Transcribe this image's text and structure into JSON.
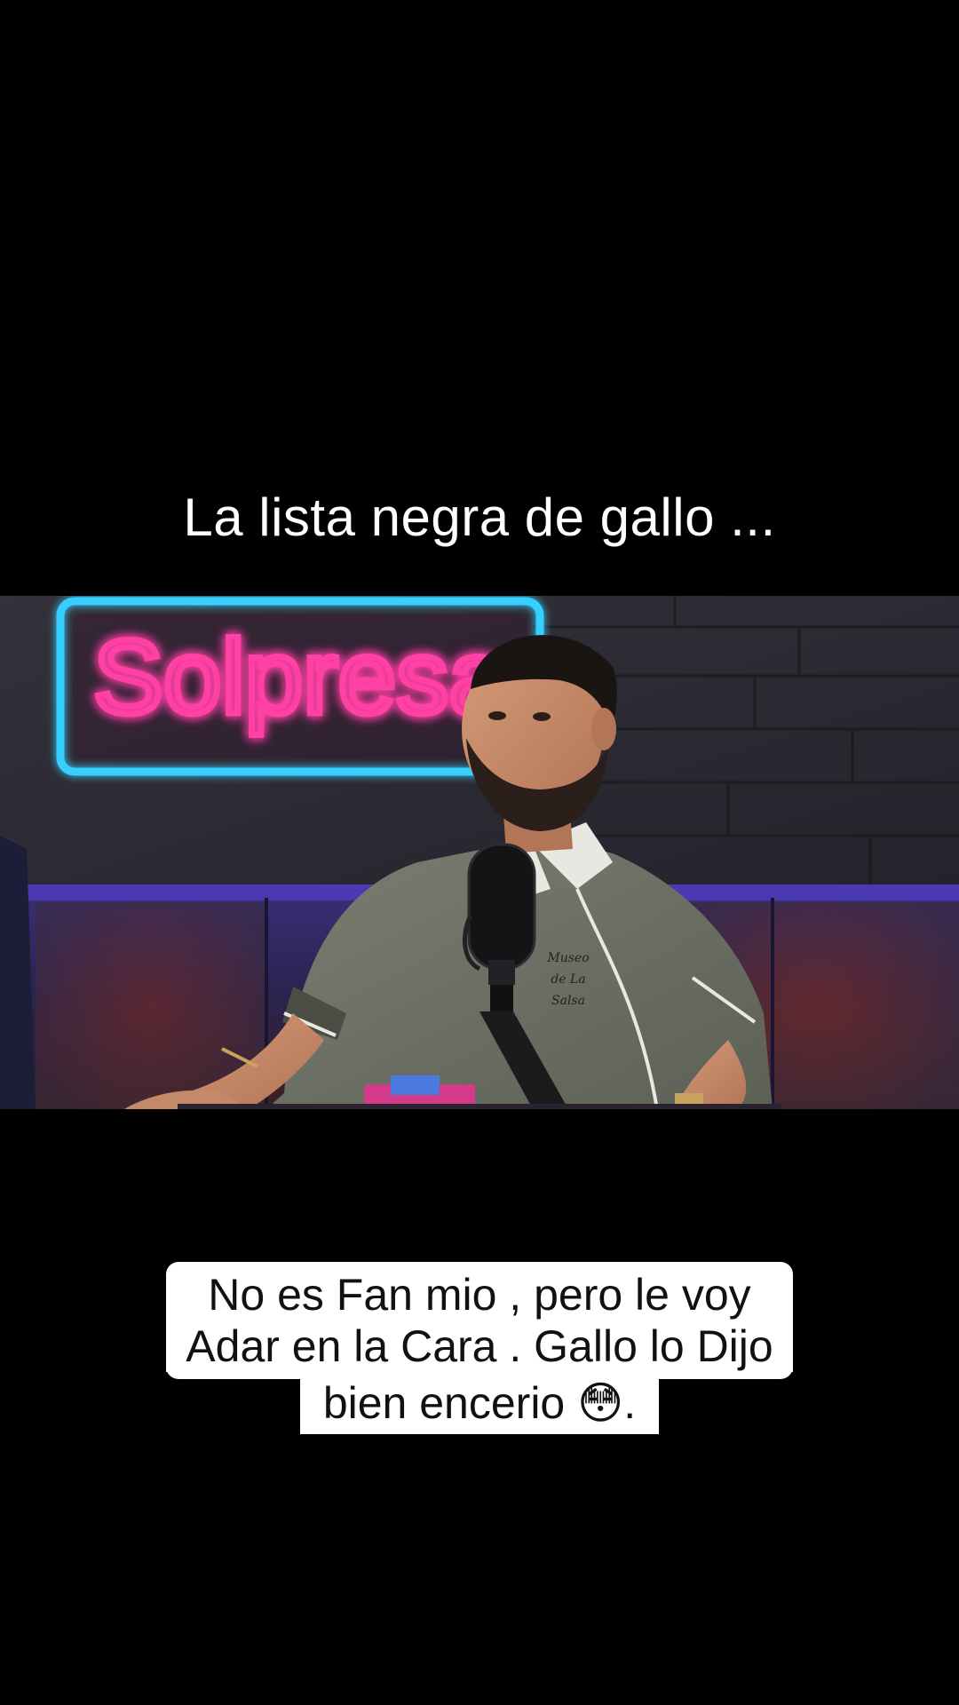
{
  "overlay": {
    "title": "La lista negra de gallo ...",
    "caption_lines": [
      "No es Fan mio , pero le voy",
      "Adar en la Cara . Gallo lo Dijo",
      "bien encerio 😳."
    ]
  },
  "video": {
    "neon_sign_text": "Solpresa",
    "shirt_logo_lines": [
      "Museo",
      "de La",
      "Salsa"
    ]
  },
  "colors": {
    "background": "#000000",
    "neon_pink": "#ff3fa4",
    "neon_blue": "#36d0ff",
    "shirt": "#6e7264",
    "stage_light": "#4b36c9"
  }
}
